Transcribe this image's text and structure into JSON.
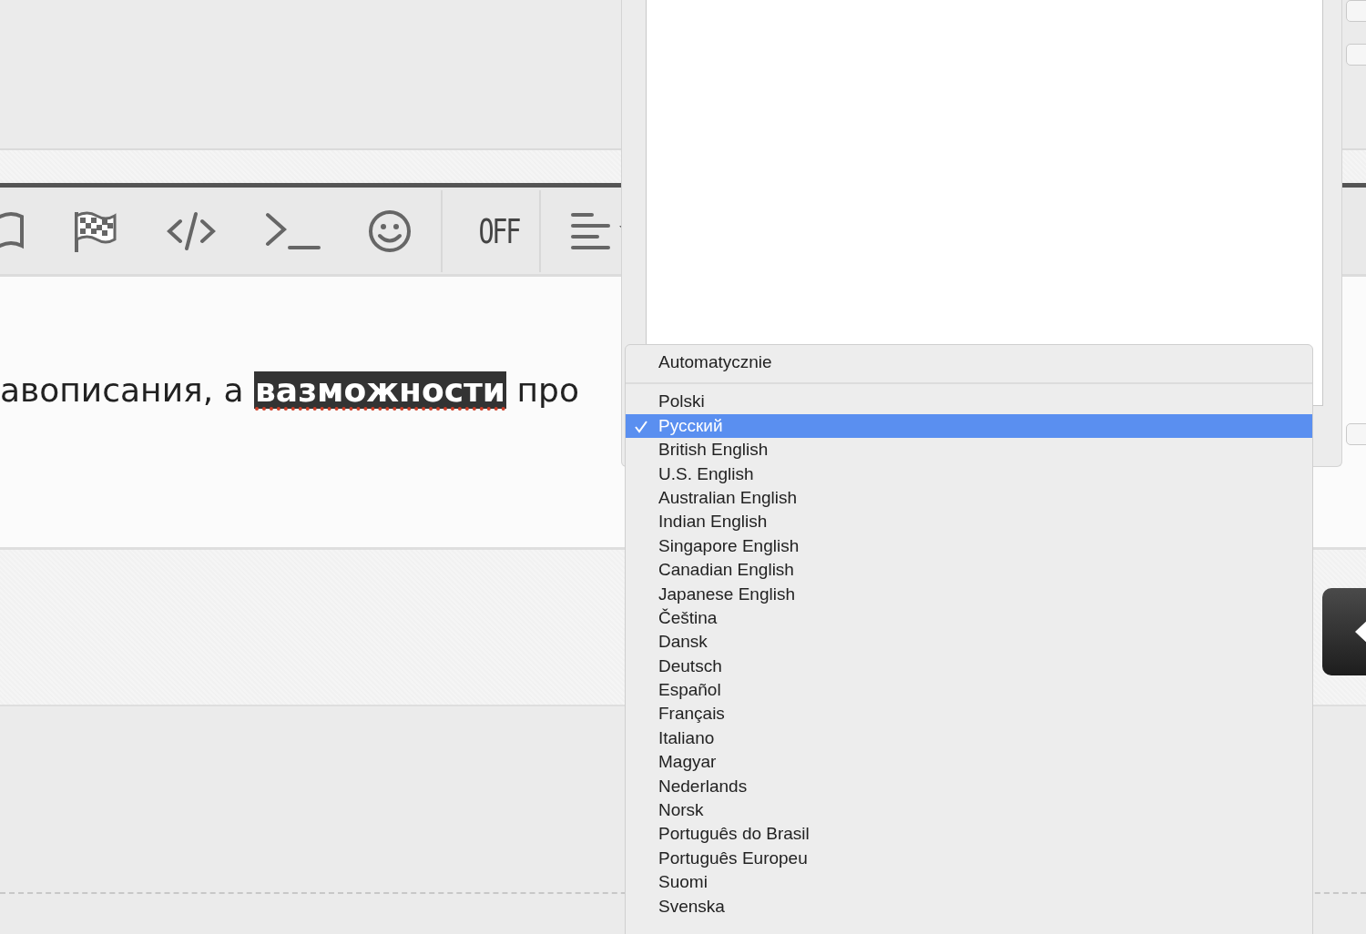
{
  "toolbar": [
    {
      "kind": "book"
    },
    {
      "kind": "flag"
    },
    {
      "kind": "code"
    },
    {
      "kind": "terminal"
    },
    {
      "kind": "smiley"
    },
    {
      "kind": "separator"
    },
    {
      "kind": "toggle",
      "label": "OFF"
    },
    {
      "kind": "separator"
    },
    {
      "kind": "align"
    }
  ],
  "editor": {
    "text": "авописания, а **вазможности** про"
  },
  "dialog": {
    "checkboxes": [
      {
        "checked": false
      },
      {
        "checked": false
      },
      {
        "checked": false
      }
    ]
  },
  "language_menu": {
    "automatic": "Automatycznie",
    "items": [
      {
        "label": "Polski",
        "selected": false
      },
      {
        "label": "Русский",
        "selected": true
      },
      {
        "label": "British English",
        "selected": false
      },
      {
        "label": "U.S. English",
        "selected": false
      },
      {
        "label": "Australian English",
        "selected": false
      },
      {
        "label": "Indian English",
        "selected": false
      },
      {
        "label": "Singapore English",
        "selected": false
      },
      {
        "label": "Canadian English",
        "selected": false
      },
      {
        "label": "Japanese English",
        "selected": false
      },
      {
        "label": "Čeština",
        "selected": false
      },
      {
        "label": "Dansk",
        "selected": false
      },
      {
        "label": "Deutsch",
        "selected": false
      },
      {
        "label": "Español",
        "selected": false
      },
      {
        "label": "Français",
        "selected": false
      },
      {
        "label": "Italiano",
        "selected": false
      },
      {
        "label": "Magyar",
        "selected": false
      },
      {
        "label": "Nederlands",
        "selected": false
      },
      {
        "label": "Norsk",
        "selected": false
      },
      {
        "label": "Português do Brasil",
        "selected": false
      },
      {
        "label": "Português Europeu",
        "selected": false
      },
      {
        "label": "Suomi",
        "selected": false
      },
      {
        "label": "Svenska",
        "selected": false
      }
    ]
  }
}
